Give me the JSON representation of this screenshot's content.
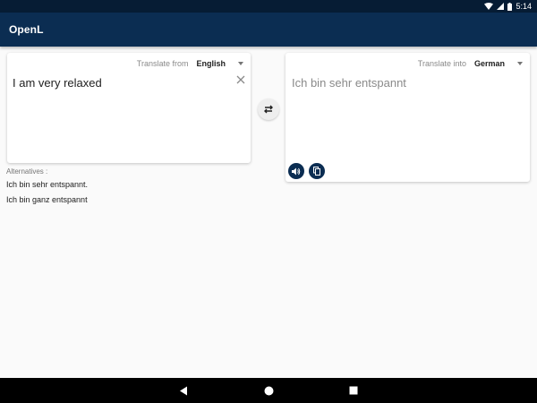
{
  "status_bar": {
    "time": "5:14",
    "icons": [
      "wifi-icon",
      "signal-icon",
      "battery-icon"
    ]
  },
  "app_bar": {
    "title": "OpenL"
  },
  "source": {
    "caption": "Translate from",
    "language": "English",
    "text": "I am very relaxed",
    "clear_icon": "close-icon"
  },
  "swap": {
    "icon": "swap-arrows-icon"
  },
  "target": {
    "caption": "Translate into",
    "language": "German",
    "text": "Ich bin sehr entspannt",
    "actions": [
      "speaker-icon",
      "copy-icon"
    ]
  },
  "alternatives": {
    "label": "Alternatives :",
    "items": [
      "Ich bin sehr entspannt.",
      "Ich bin ganz entspannt"
    ]
  },
  "nav_bar": {
    "icons": [
      "back-triangle-icon",
      "home-circle-icon",
      "recents-square-icon"
    ]
  },
  "colors": {
    "status_bar": "#061c34",
    "app_bar": "#0b2d52",
    "background": "#fafafa",
    "card": "#ffffff",
    "accent_button": "#0b2d52",
    "hint_text": "#8a8a8a"
  }
}
